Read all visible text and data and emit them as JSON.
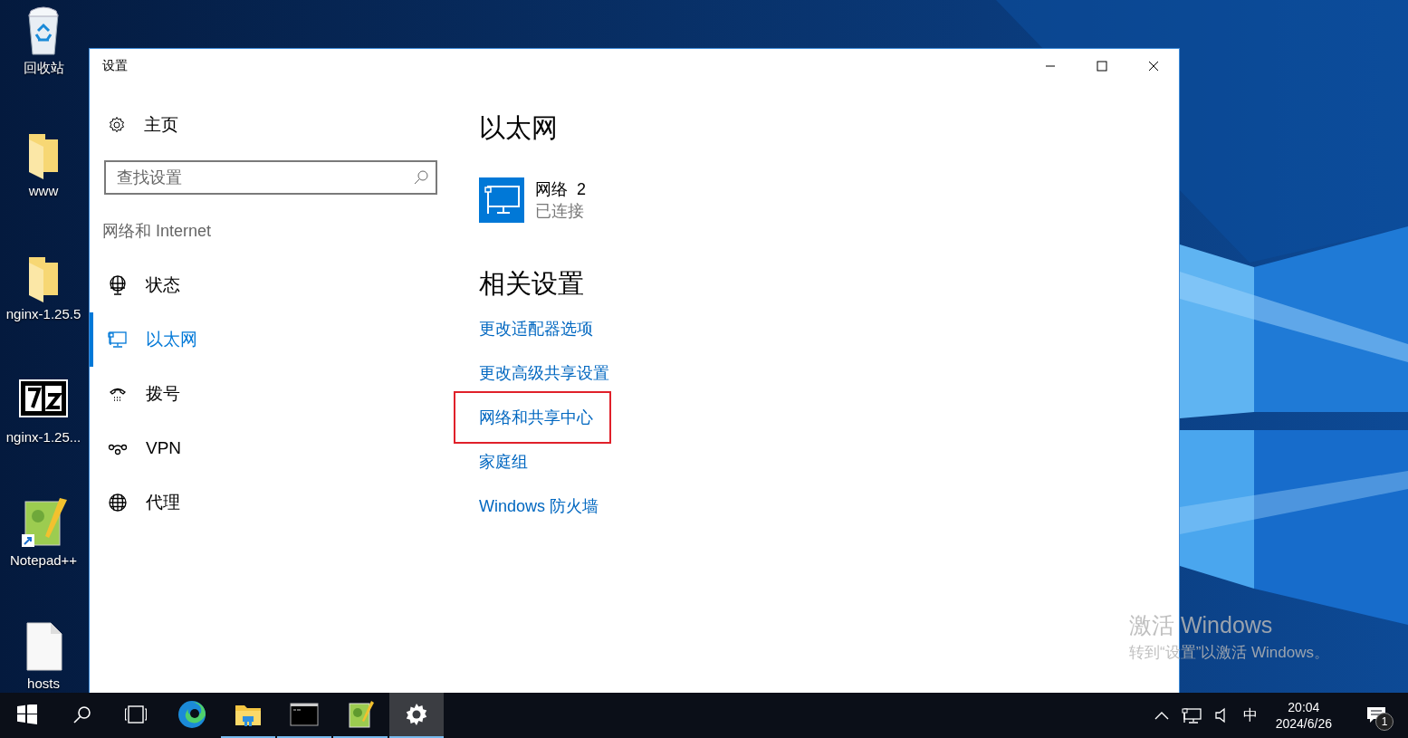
{
  "desktop_icons": [
    {
      "label": "回收站",
      "kind": "recycle"
    },
    {
      "label": "www",
      "kind": "folder"
    },
    {
      "label": "nginx-1.25.5",
      "kind": "folder"
    },
    {
      "label": "nginx-1.25...",
      "kind": "archive"
    },
    {
      "label": "Notepad++",
      "kind": "notepad"
    },
    {
      "label": "hosts",
      "kind": "file"
    }
  ],
  "window": {
    "title": "设置"
  },
  "sidebar": {
    "home": "主页",
    "search": {
      "placeholder": "查找设置"
    },
    "section": "网络和 Internet",
    "items": [
      {
        "label": "状态",
        "kind": "status",
        "selected": false
      },
      {
        "label": "以太网",
        "kind": "ethernet",
        "selected": true
      },
      {
        "label": "拨号",
        "kind": "dialup",
        "selected": false
      },
      {
        "label": "VPN",
        "kind": "vpn",
        "selected": false
      },
      {
        "label": "代理",
        "kind": "proxy",
        "selected": false
      }
    ]
  },
  "main": {
    "title": "以太网",
    "network": {
      "name": "网络  2",
      "status": "已连接"
    },
    "related_heading": "相关设置",
    "links": [
      {
        "label": "更改适配器选项",
        "highlighted": false
      },
      {
        "label": "更改高级共享设置",
        "highlighted": false
      },
      {
        "label": "网络和共享中心",
        "highlighted": true
      },
      {
        "label": "家庭组",
        "highlighted": false
      },
      {
        "label": "Windows 防火墙",
        "highlighted": false
      }
    ]
  },
  "taskbar": {
    "apps": [
      {
        "kind": "edge",
        "running": false,
        "selected": false
      },
      {
        "kind": "explorer",
        "running": true,
        "selected": false
      },
      {
        "kind": "terminal",
        "running": true,
        "selected": false
      },
      {
        "kind": "notepad",
        "running": true,
        "selected": false
      },
      {
        "kind": "settings",
        "running": true,
        "selected": true
      }
    ],
    "tray": {
      "ime": "中",
      "time": "20:04",
      "date": "2024/6/26",
      "notifications": "1"
    }
  },
  "activation": {
    "title": "激活 Windows",
    "hint": "转到“设置”以激活 Windows。"
  }
}
